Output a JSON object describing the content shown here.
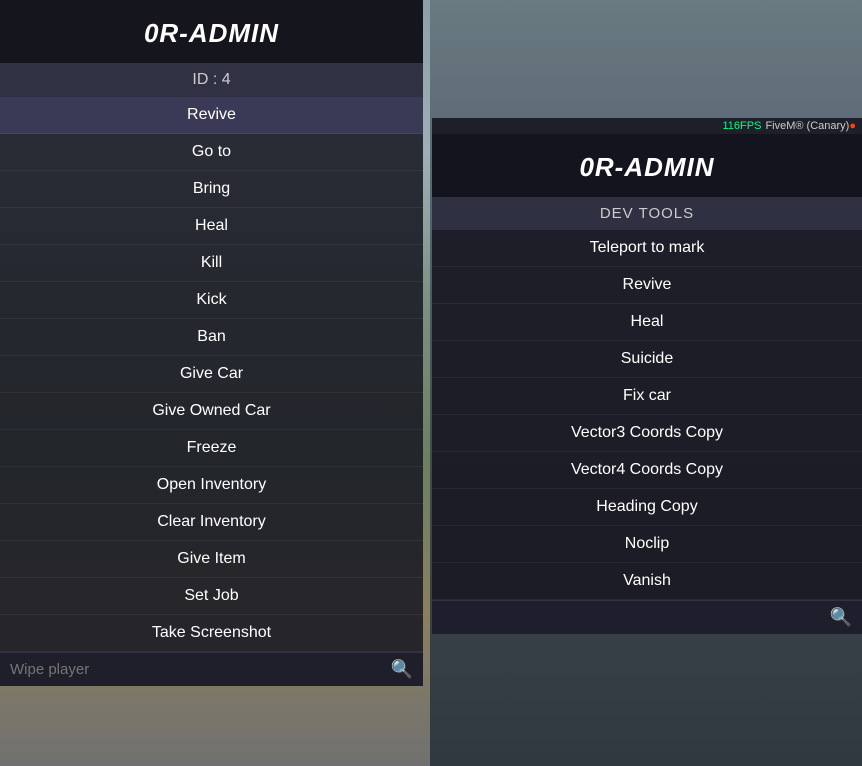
{
  "left_panel": {
    "title": "0R-ADMIN",
    "id_label": "ID : 4",
    "items": [
      {
        "label": "Revive",
        "active": true
      },
      {
        "label": "Go to",
        "active": false
      },
      {
        "label": "Bring",
        "active": false
      },
      {
        "label": "Heal",
        "active": false
      },
      {
        "label": "Kill",
        "active": false
      },
      {
        "label": "Kick",
        "active": false
      },
      {
        "label": "Ban",
        "active": false
      },
      {
        "label": "Give Car",
        "active": false
      },
      {
        "label": "Give Owned Car",
        "active": false
      },
      {
        "label": "Freeze",
        "active": false
      },
      {
        "label": "Open Inventory",
        "active": false
      },
      {
        "label": "Clear Inventory",
        "active": false
      },
      {
        "label": "Give Item",
        "active": false
      },
      {
        "label": "Set Job",
        "active": false
      },
      {
        "label": "Take Screenshot",
        "active": false
      }
    ],
    "search_placeholder": "Wipe player",
    "search_icon": "🔍"
  },
  "right_panel": {
    "title": "0R-ADMIN",
    "fps": "116FPS",
    "client_info": "FiveM® (Canary)",
    "section_label": "DEV TOOLS",
    "items": [
      {
        "label": "Teleport to mark"
      },
      {
        "label": "Revive"
      },
      {
        "label": "Heal"
      },
      {
        "label": "Suicide"
      },
      {
        "label": "Fix car"
      },
      {
        "label": "Vector3 Coords Copy"
      },
      {
        "label": "Vector4 Coords Copy"
      },
      {
        "label": "Heading Copy"
      },
      {
        "label": "Noclip"
      },
      {
        "label": "Vanish"
      }
    ],
    "search_placeholder": "",
    "search_icon": "🔍"
  }
}
